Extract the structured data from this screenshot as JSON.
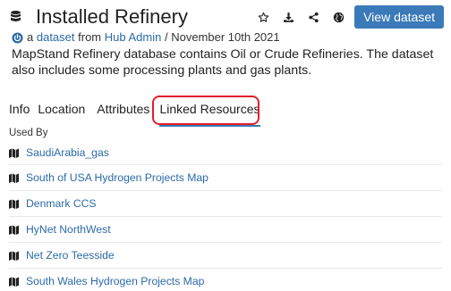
{
  "page": {
    "title": "Installed Refinery",
    "title_icon": "database-icon"
  },
  "actions": {
    "star_icon": "star-icon",
    "download_icon": "download-icon",
    "share_icon": "share-icon",
    "globe_icon": "globe-icon",
    "view_label": "View dataset"
  },
  "byline": {
    "icon": "power-icon",
    "prefix": "a",
    "type_link": "dataset",
    "from_text": "from",
    "author": "Hub Admin",
    "date": "/ November 10th 2021"
  },
  "description": "MapStand Refinery database contains Oil or Crude Refineries. The dataset also includes some processing plants and gas plants.",
  "tabs": [
    {
      "label": "Info",
      "active": false
    },
    {
      "label": "Location",
      "active": false
    },
    {
      "label": "Attributes",
      "active": false
    },
    {
      "label": "Linked Resources",
      "active": true
    }
  ],
  "colors": {
    "accent": "#3b7ab8",
    "link": "#2c6aa8",
    "highlight": "#e0202a"
  },
  "used_by": {
    "heading": "Used By",
    "items": [
      {
        "label": "SaudiArabia_gas",
        "icon": "map-icon"
      },
      {
        "label": "South of USA Hydrogen Projects Map",
        "icon": "map-icon"
      },
      {
        "label": "Denmark CCS",
        "icon": "map-icon"
      },
      {
        "label": "HyNet NorthWest",
        "icon": "map-icon"
      },
      {
        "label": "Net Zero Teesside",
        "icon": "map-icon"
      },
      {
        "label": "South Wales Hydrogen Projects Map",
        "icon": "map-icon"
      }
    ]
  }
}
